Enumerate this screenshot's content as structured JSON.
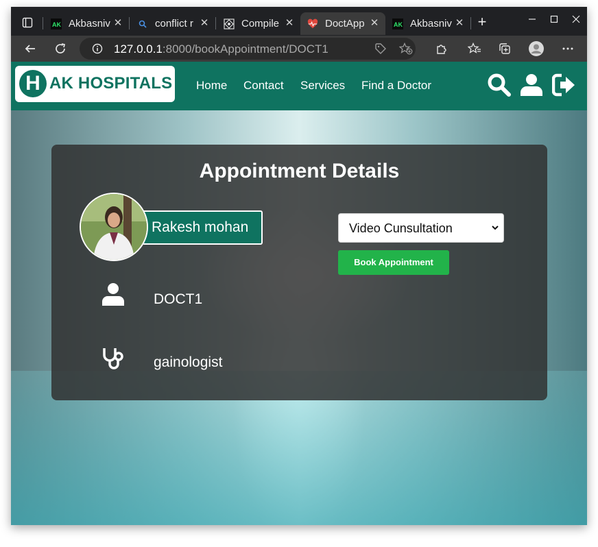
{
  "browser": {
    "tabs": [
      {
        "title": "Akbasniv",
        "icon": "ak-favicon"
      },
      {
        "title": "conflict r",
        "icon": "search-favicon"
      },
      {
        "title": "Compile",
        "icon": "compile-favicon"
      },
      {
        "title": "DoctApp",
        "icon": "heartbeat-favicon",
        "active": true
      },
      {
        "title": "Akbasniv",
        "icon": "ak-favicon"
      }
    ],
    "new_tab": "+",
    "window_controls": [
      "minimize",
      "maximize",
      "close"
    ],
    "url_host": "127.0.0.1",
    "url_path": ":8000/bookAppointment/DOCT1"
  },
  "navbar": {
    "logo_letter": "H",
    "logo_text": "AK HOSPITALS",
    "links": [
      "Home",
      "Contact",
      "Services",
      "Find a Doctor"
    ],
    "icons": [
      "search-icon",
      "user-icon",
      "logout-icon"
    ]
  },
  "appointment": {
    "title": "Appointment Details",
    "doctor_name": "Rakesh mohan",
    "doctor_id": "DOCT1",
    "specialization": "gainologist",
    "consultation_type": "Video Cunsultation",
    "book_button": "Book Appointment"
  },
  "colors": {
    "brand": "#0f7360",
    "book_button": "#22b34a",
    "card_bg": "rgba(48,48,48,0.84)"
  }
}
